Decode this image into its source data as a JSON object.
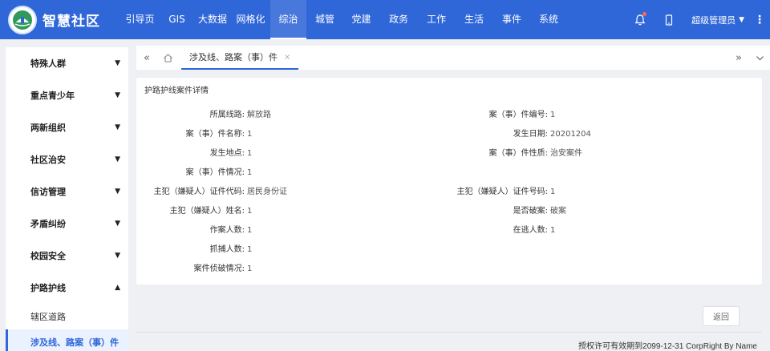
{
  "header": {
    "app_title": "智慧社区",
    "nav": [
      "引导页",
      "GIS",
      "大数据",
      "网格化",
      "综治",
      "城管",
      "党建",
      "政务",
      "工作",
      "生活",
      "事件",
      "系统"
    ],
    "active_nav": "综治",
    "user_name": "超级管理员",
    "accent_color": "#2f66d8"
  },
  "sidebar": {
    "groups": [
      "特殊人群",
      "重点青少年",
      "两新组织",
      "社区治安",
      "信访管理",
      "矛盾纠纷",
      "校园安全",
      "护路护线"
    ],
    "expanded_group": "护路护线",
    "sub_items": [
      "辖区道路",
      "涉及线、路案（事）件"
    ],
    "active_sub": "涉及线、路案（事）件"
  },
  "tabs": [
    {
      "label": "涉及线、路案（事）件"
    }
  ],
  "detail": {
    "title": "护路护线案件详情",
    "left": [
      {
        "label": "所属线路:",
        "value": "解放路"
      },
      {
        "label": "案（事）件名称:",
        "value": "1"
      },
      {
        "label": "发生地点:",
        "value": "1"
      },
      {
        "label": "案（事）件情况:",
        "value": "1"
      },
      {
        "label": "主犯（嫌疑人）证件代码:",
        "value": "居民身份证"
      },
      {
        "label": "主犯（嫌疑人）姓名:",
        "value": "1"
      },
      {
        "label": "作案人数:",
        "value": "1"
      },
      {
        "label": "抓捕人数:",
        "value": "1"
      },
      {
        "label": "案件侦破情况:",
        "value": "1"
      }
    ],
    "right": [
      {
        "label": "案（事）件编号:",
        "value": "1"
      },
      {
        "label": "发生日期:",
        "value": "20201204"
      },
      {
        "label": "案（事）件性质:",
        "value": "治安案件"
      },
      {
        "label": "",
        "value": ""
      },
      {
        "label": "主犯（嫌疑人）证件号码:",
        "value": "1"
      },
      {
        "label": "是否破案:",
        "value": "破案"
      },
      {
        "label": "在逃人数:",
        "value": "1"
      }
    ]
  },
  "actions": {
    "back_label": "返回"
  },
  "footer": {
    "copyright": "授权许可有效期到2099-12-31 CorpRight By Name"
  }
}
